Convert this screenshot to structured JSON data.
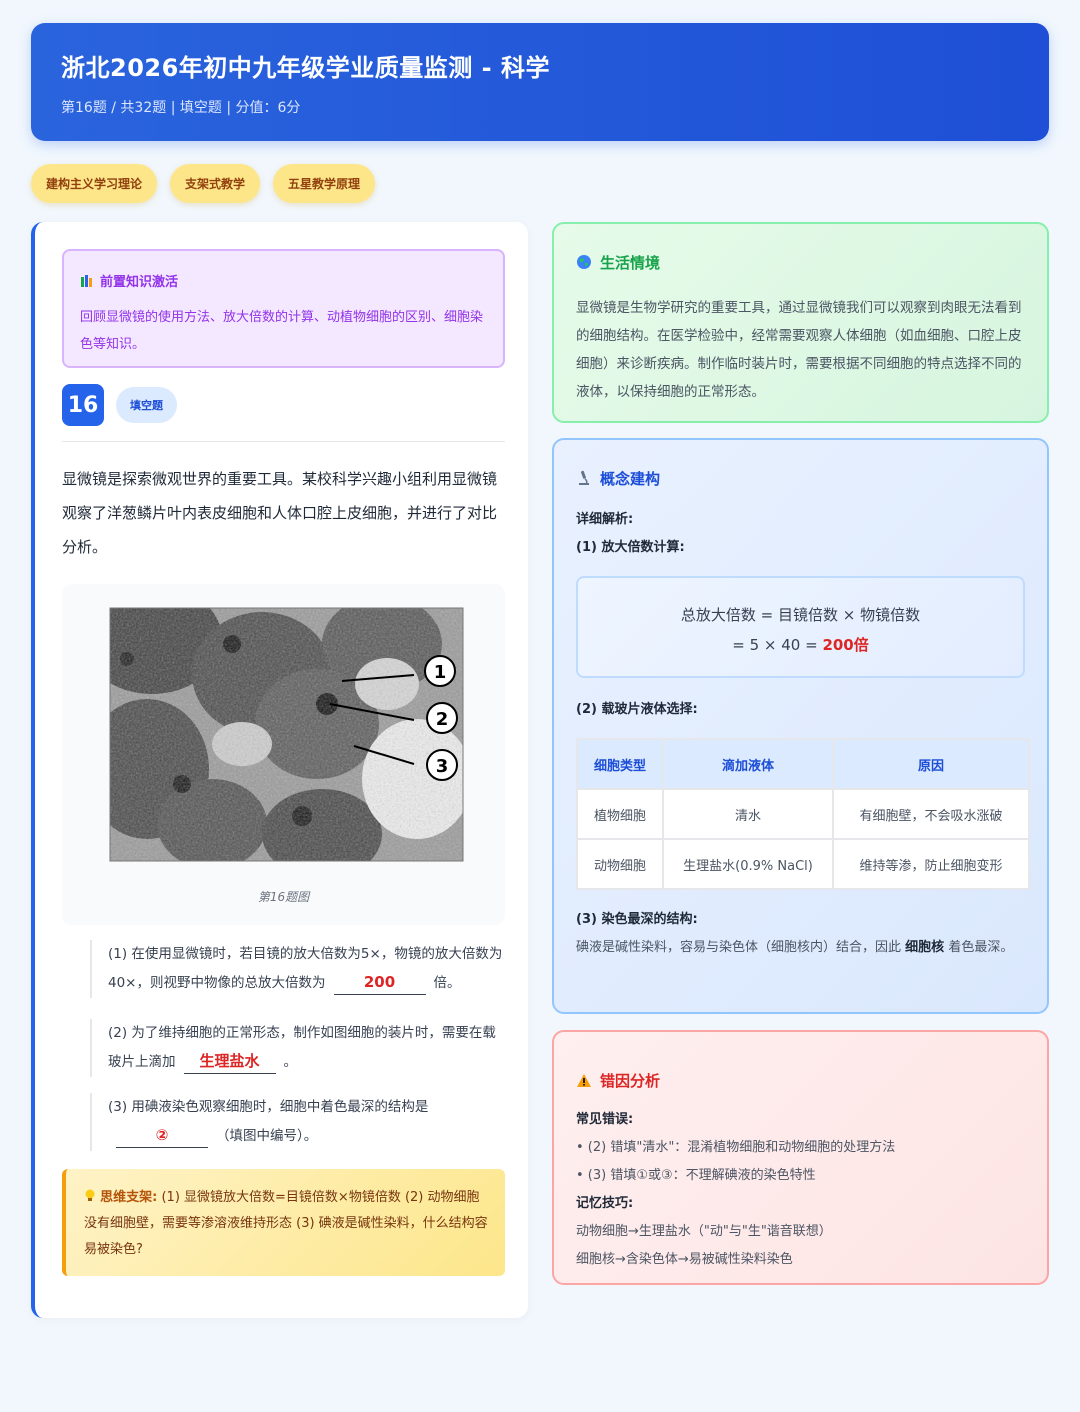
{
  "header": {
    "title": "浙北2026年初中九年级学业质量监测 - 科学",
    "subtitle": "第16题 / 共32题 | 填空题 | 分值：6分"
  },
  "tags": [
    "建构主义学习理论",
    "支架式教学",
    "五星教学原理"
  ],
  "prior": {
    "title": "前置知识激活",
    "text": "回顾显微镜的使用方法、放大倍数的计算、动植物细胞的区别、细胞染色等知识。"
  },
  "question": {
    "number": "16",
    "type": "填空题",
    "stem": "显微镜是探索微观世界的重要工具。某校科学兴趣小组利用显微镜观察了洋葱鳞片叶内表皮细胞和人体口腔上皮细胞，并进行了对比分析。",
    "figure_caption": "第16题图",
    "figure_labels": [
      "①",
      "②",
      "③"
    ],
    "sub1_text": "(1) 在使用显微镜时，若目镜的放大倍数为5×，物镜的放大倍数为40×，则视野中物像的总放大倍数为",
    "sub1_answer": "200",
    "sub1_suffix": "倍。",
    "sub2_text": "(2) 为了维持细胞的正常形态，制作如图细胞的装片时，需要在载玻片上滴加",
    "sub2_answer": "生理盐水",
    "sub2_suffix": "。",
    "sub3_text": "(3) 用碘液染色观察细胞时，细胞中着色最深的结构是",
    "sub3_answer": "②",
    "sub3_suffix": "（填图中编号）。",
    "tip_label": "思维支架:",
    "tip_text": "(1) 显微镜放大倍数=目镜倍数×物镜倍数 (2) 动物细胞没有细胞壁，需要等渗溶液维持形态 (3) 碘液是碱性染料，什么结构容易被染色?"
  },
  "life": {
    "title": "生活情境",
    "text": "显微镜是生物学研究的重要工具，通过显微镜我们可以观察到肉眼无法看到的细胞结构。在医学检验中，经常需要观察人体细胞（如血细胞、口腔上皮细胞）来诊断疾病。制作临时装片时，需要根据不同细胞的特点选择不同的液体，以保持细胞的正常形态。"
  },
  "concept": {
    "title": "概念建构",
    "detail_label": "详细解析:",
    "part1_label": "(1) 放大倍数计算:",
    "formula_line1": "总放大倍数 = 目镜倍数 × 物镜倍数",
    "formula_line2_prefix": "= 5 × 40 =",
    "formula_result": "200倍",
    "part2_label": "(2) 载玻片液体选择:",
    "table_headers": [
      "细胞类型",
      "滴加液体",
      "原因"
    ],
    "table_rows": [
      [
        "植物细胞",
        "清水",
        "有细胞壁，不会吸水涨破"
      ],
      [
        "动物细胞",
        "生理盐水(0.9% NaCl)",
        "维持等渗，防止细胞变形"
      ]
    ],
    "part3_label": "(3) 染色最深的结构:",
    "part3_text_a": "碘液是碱性染料，容易与染色体（细胞核内）结合，因此",
    "part3_bold": "细胞核",
    "part3_text_b": "着色最深。"
  },
  "error": {
    "title": "错因分析",
    "common_label": "常见错误:",
    "errors": [
      "• (2) 错填\"清水\"：混淆植物细胞和动物细胞的处理方法",
      "• (3) 错填①或③：不理解碘液的染色特性"
    ],
    "memory_label": "记忆技巧:",
    "tips": [
      "动物细胞→生理盐水（\"动\"与\"生\"谐音联想）",
      "细胞核→含染色体→易被碱性染料染色"
    ]
  },
  "colors": {
    "primary": "#2563eb",
    "answer": "#dc2626",
    "prior": "#9333ea",
    "life": "#16a34a",
    "error": "#dc2626"
  },
  "icons": [
    "books-icon",
    "globe-icon",
    "microscope-icon",
    "warning-icon",
    "lightbulb-icon"
  ]
}
